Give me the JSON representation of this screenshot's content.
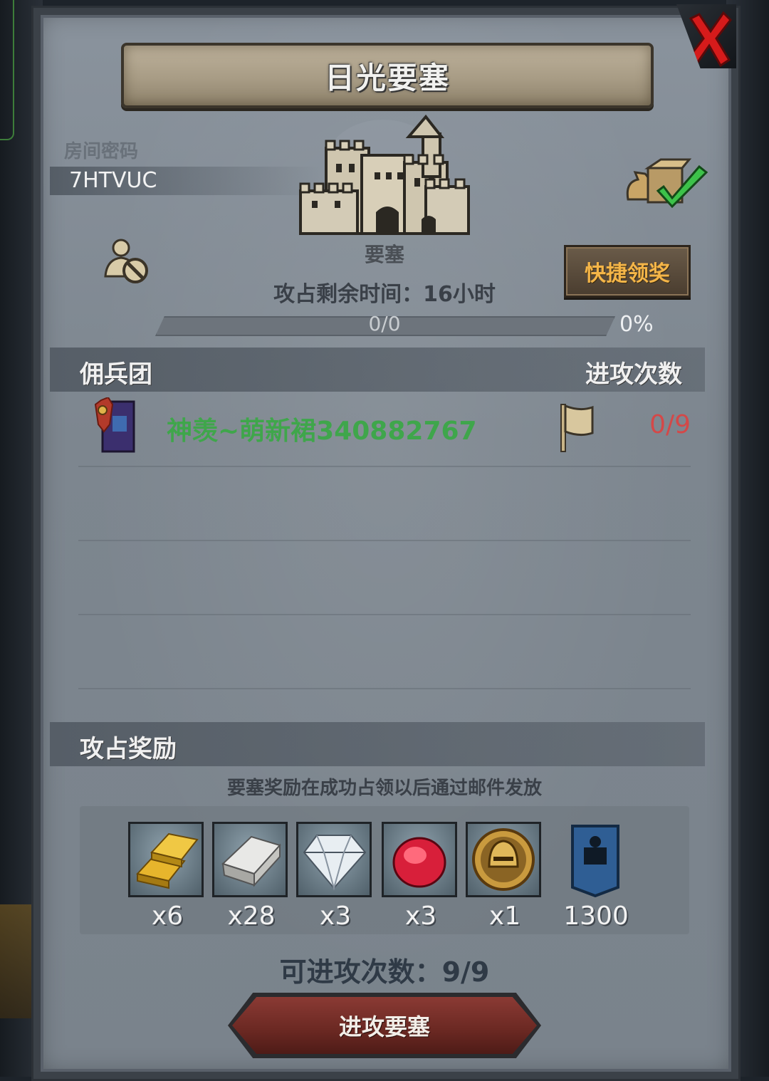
{
  "title": "日光要塞",
  "room": {
    "label": "房间密码",
    "code": "7HTVUC"
  },
  "fortress": {
    "name": "要塞",
    "time_remaining": "攻占剩余时间：16小时"
  },
  "quick_claim_label": "快捷领奖",
  "progress": {
    "text": "0/0",
    "percent_text": "0%",
    "fraction": 0
  },
  "mercenary_section": {
    "title": "佣兵团",
    "attacks_header": "进攻次数",
    "rows": [
      {
        "name": "神羡~萌新裙340882767",
        "attacks": "0/9"
      }
    ]
  },
  "rewards": {
    "title": "攻占奖励",
    "note": "要塞奖励在成功占领以后通过邮件发放",
    "items": [
      {
        "icon": "gold-bar-icon",
        "qty": "x6"
      },
      {
        "icon": "silver-bar-icon",
        "qty": "x28"
      },
      {
        "icon": "diamond-icon",
        "qty": "x3"
      },
      {
        "icon": "ruby-icon",
        "qty": "x3"
      },
      {
        "icon": "knight-helmet-coin-icon",
        "qty": "x1"
      },
      {
        "icon": "guild-banner-points-icon",
        "qty": "1300"
      }
    ]
  },
  "available_attacks": "可进攻次数：9/9",
  "attack_button_label": "进攻要塞",
  "colors": {
    "merc_name": "#3fa64b",
    "attack_count": "#d44848",
    "quick_claim_text": "#f4b548"
  }
}
